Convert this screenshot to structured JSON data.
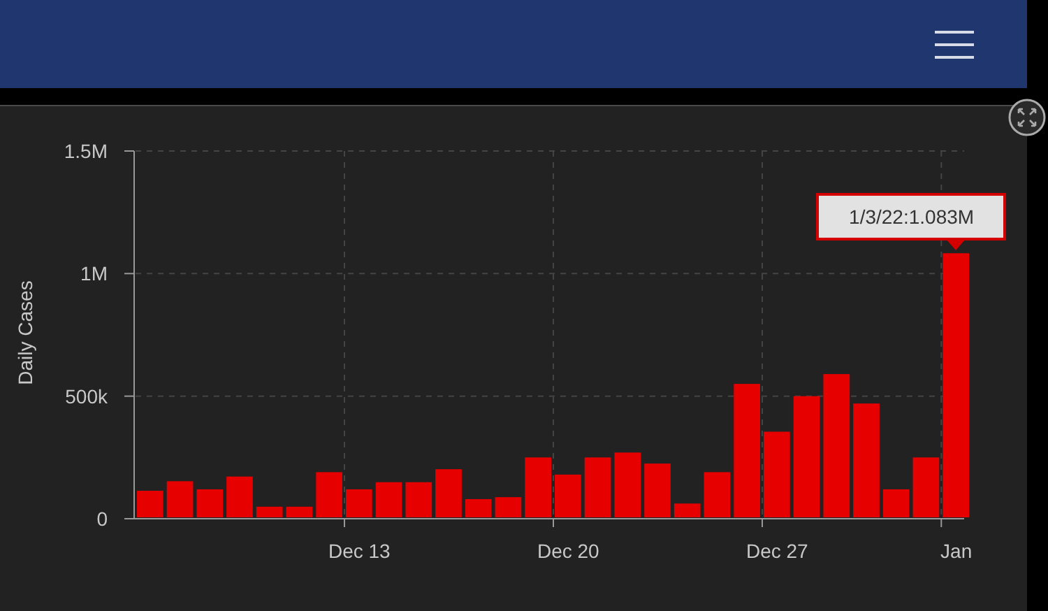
{
  "chart": {
    "chart_data": {
      "type": "bar",
      "ylabel": "Daily Cases",
      "categories": [
        null,
        null,
        null,
        null,
        null,
        null,
        null,
        "Dec 13",
        null,
        null,
        null,
        null,
        null,
        null,
        "Dec 20",
        null,
        null,
        null,
        null,
        null,
        null,
        "Dec 27",
        null,
        null,
        null,
        null,
        null,
        "Jan"
      ],
      "grid": true,
      "series": [
        {
          "color": "#e60000",
          "values": [
            114000,
            153000,
            120000,
            172000,
            49000,
            49000,
            190000,
            120000,
            149000,
            149000,
            202000,
            80000,
            88000,
            250000,
            180000,
            250000,
            270000,
            225000,
            62000,
            190000,
            550000,
            355000,
            500000,
            590000,
            470000,
            120000,
            250000,
            1083000
          ]
        }
      ],
      "ylim": [
        0,
        1500000
      ],
      "yticks": [
        {
          "value": 0,
          "label": "0"
        },
        {
          "value": 500000,
          "label": "500k"
        },
        {
          "value": 1000000,
          "label": "1M"
        },
        {
          "value": 1500000,
          "label": "1.5M"
        }
      ],
      "annotations": [
        {
          "x": "Jan",
          "y": 1083000,
          "text": "1/3/22:1.083M"
        }
      ]
    }
  }
}
